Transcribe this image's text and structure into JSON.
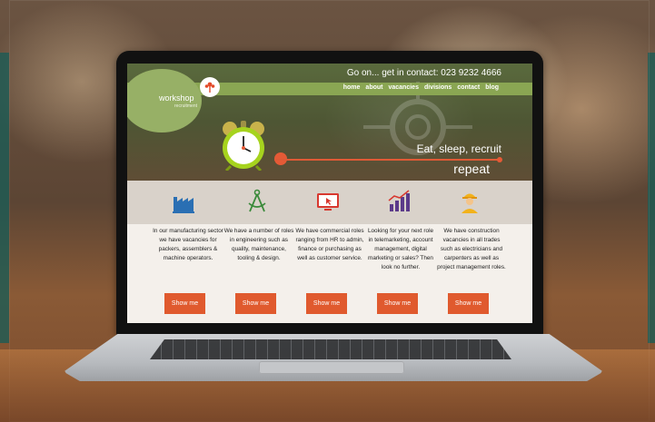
{
  "site": {
    "contact_line": "Go on... get in contact: 023 9232 4666",
    "logo_text": "workshop",
    "logo_sub": "recruitment",
    "nav": [
      "home",
      "about",
      "vacancies",
      "divisions",
      "contact",
      "blog"
    ],
    "tagline": "Eat, sleep, recruit",
    "tagline2": "repeat"
  },
  "services": [
    {
      "icon": "factory-icon",
      "text": "In our manufacturing sector we have vacancies for packers, assemblers & machine operators.",
      "button": "Show me"
    },
    {
      "icon": "compass-icon",
      "text": "We have a number of roles in engineering such as quality, maintenance, tooling & design.",
      "button": "Show me"
    },
    {
      "icon": "monitor-icon",
      "text": "We have commercial roles ranging from HR to admin, finance or purchasing as well as customer service.",
      "button": "Show me"
    },
    {
      "icon": "bar-chart-icon",
      "text": "Looking for your next role in telemarketing, account management, digital marketing or sales? Then look no further.",
      "button": "Show me"
    },
    {
      "icon": "worker-icon",
      "text": "We have construction vacancies in all trades such as electricians and carpenters as well as project management roles.",
      "button": "Show me"
    }
  ],
  "colors": {
    "accent": "#e05a2e",
    "nav_green": "#8aa653",
    "blue_icon": "#2a6fb3",
    "green_icon": "#3a8a3a",
    "red_icon": "#d8382f",
    "purple_icon": "#5b3a8a",
    "yellow_icon": "#f2b21b"
  }
}
